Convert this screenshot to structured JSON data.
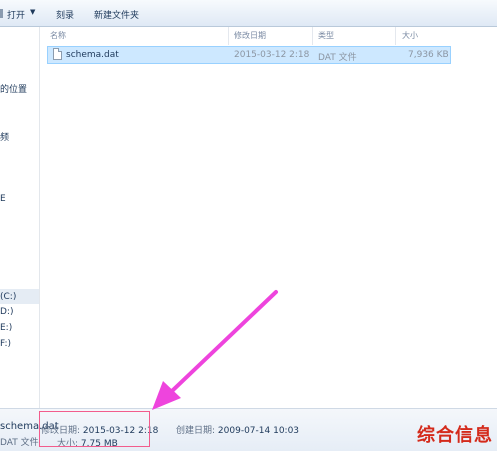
{
  "toolbar": {
    "open_label": "打开",
    "burn_label": "刻录",
    "new_folder_label": "新建文件夹"
  },
  "sidebar": {
    "items": [
      {
        "label": "的位置"
      },
      {
        "label": "频"
      },
      {
        "label": "E"
      },
      {
        "label": "(C:)"
      },
      {
        "label": "D:)"
      },
      {
        "label": "E:)"
      },
      {
        "label": "F:)"
      }
    ]
  },
  "columns": {
    "name": "名称",
    "modified": "修改日期",
    "type": "类型",
    "size": "大小"
  },
  "file": {
    "name": "schema.dat",
    "modified": "2015-03-12 2:18",
    "type": "DAT 文件",
    "size": "7,936 KB"
  },
  "details": {
    "filename": "schema.dat",
    "type": "DAT 文件",
    "modified_label": "修改日期:",
    "modified_value": "2015-03-12 2:18",
    "size_label": "大小:",
    "size_value": "7.75 MB",
    "created_label": "创建日期:",
    "created_value": "2009-07-14 10:03"
  },
  "watermark": "综合信息",
  "colors": {
    "arrow": "#ee44dd",
    "highlight_box": "#f25c8c",
    "selection": "#cde8ff",
    "watermark": "#d42a1b"
  }
}
